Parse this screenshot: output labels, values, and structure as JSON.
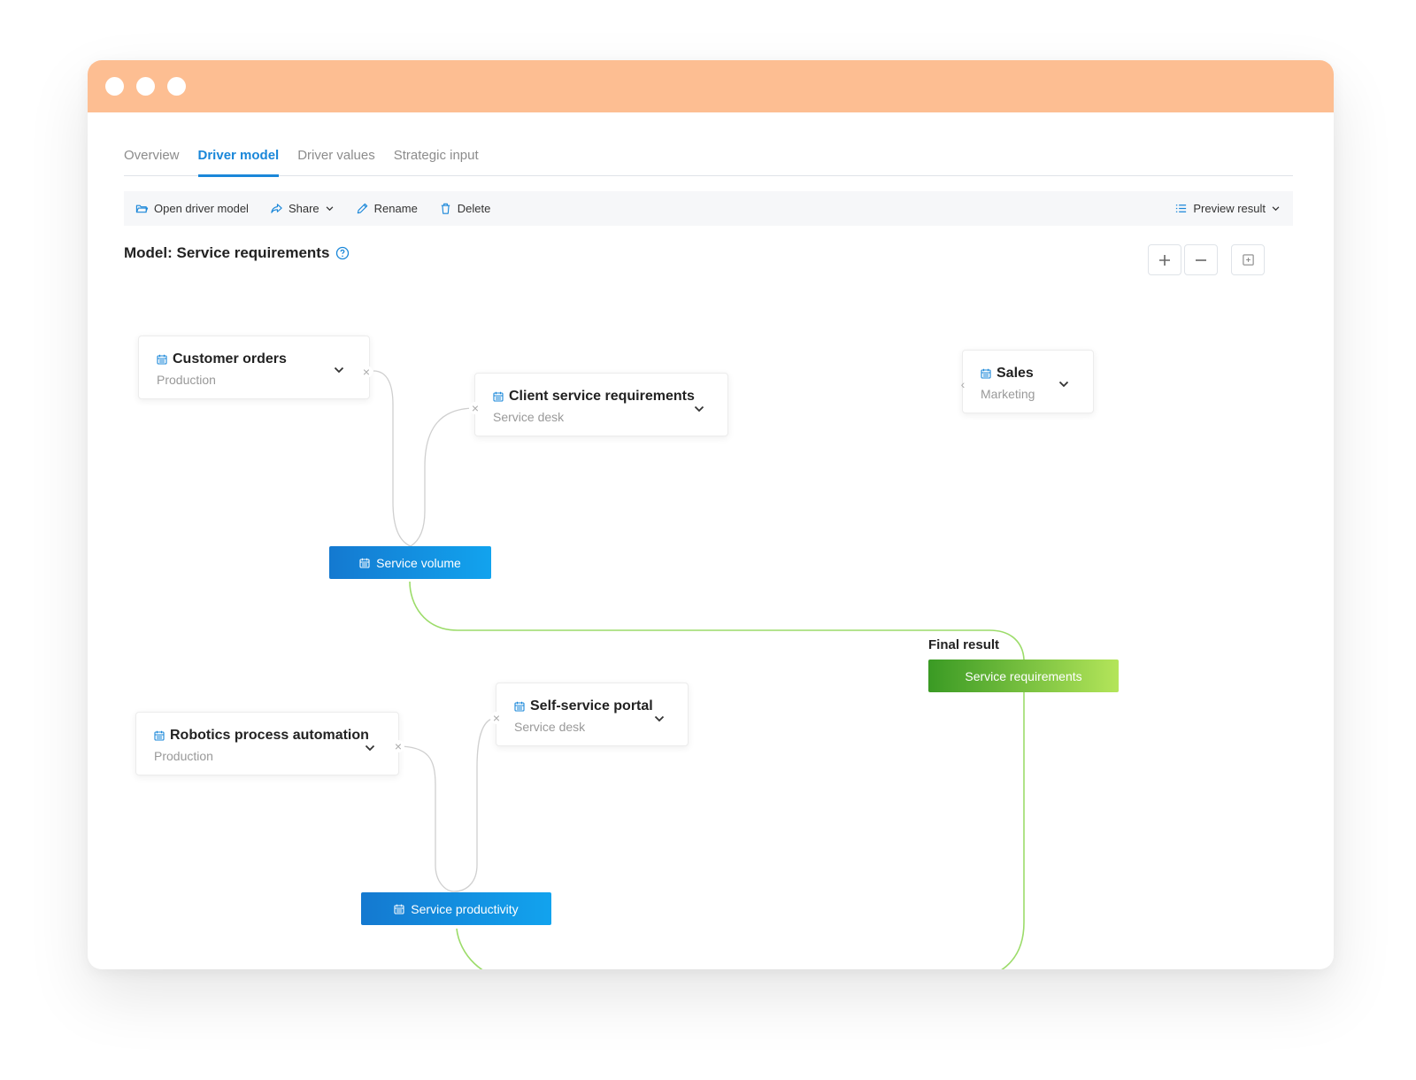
{
  "window": {
    "titlebar_color": "#fdbe92"
  },
  "tabs": [
    {
      "label": "Overview",
      "active": false
    },
    {
      "label": "Driver model",
      "active": true
    },
    {
      "label": "Driver values",
      "active": false
    },
    {
      "label": "Strategic input",
      "active": false
    }
  ],
  "toolbar": {
    "open_label": "Open driver model",
    "share_label": "Share",
    "rename_label": "Rename",
    "delete_label": "Delete",
    "preview_label": "Preview result"
  },
  "model": {
    "title": "Model: Service requirements"
  },
  "nodes": {
    "customer_orders": {
      "title": "Customer orders",
      "sub": "Production"
    },
    "client_service": {
      "title": "Client service requirements",
      "sub": "Service desk"
    },
    "sales": {
      "title": "Sales",
      "sub": "Marketing"
    },
    "robotics": {
      "title": "Robotics process automation",
      "sub": "Production"
    },
    "self_service": {
      "title": "Self-service portal",
      "sub": "Service desk"
    }
  },
  "aggregates": {
    "service_volume": "Service volume",
    "service_productivity": "Service productivity"
  },
  "final": {
    "heading": "Final result",
    "label": "Service requirements"
  },
  "colors": {
    "accent": "#1a87d9",
    "link_green": "#9cdc6a",
    "link_gray": "#cfcfcf"
  }
}
